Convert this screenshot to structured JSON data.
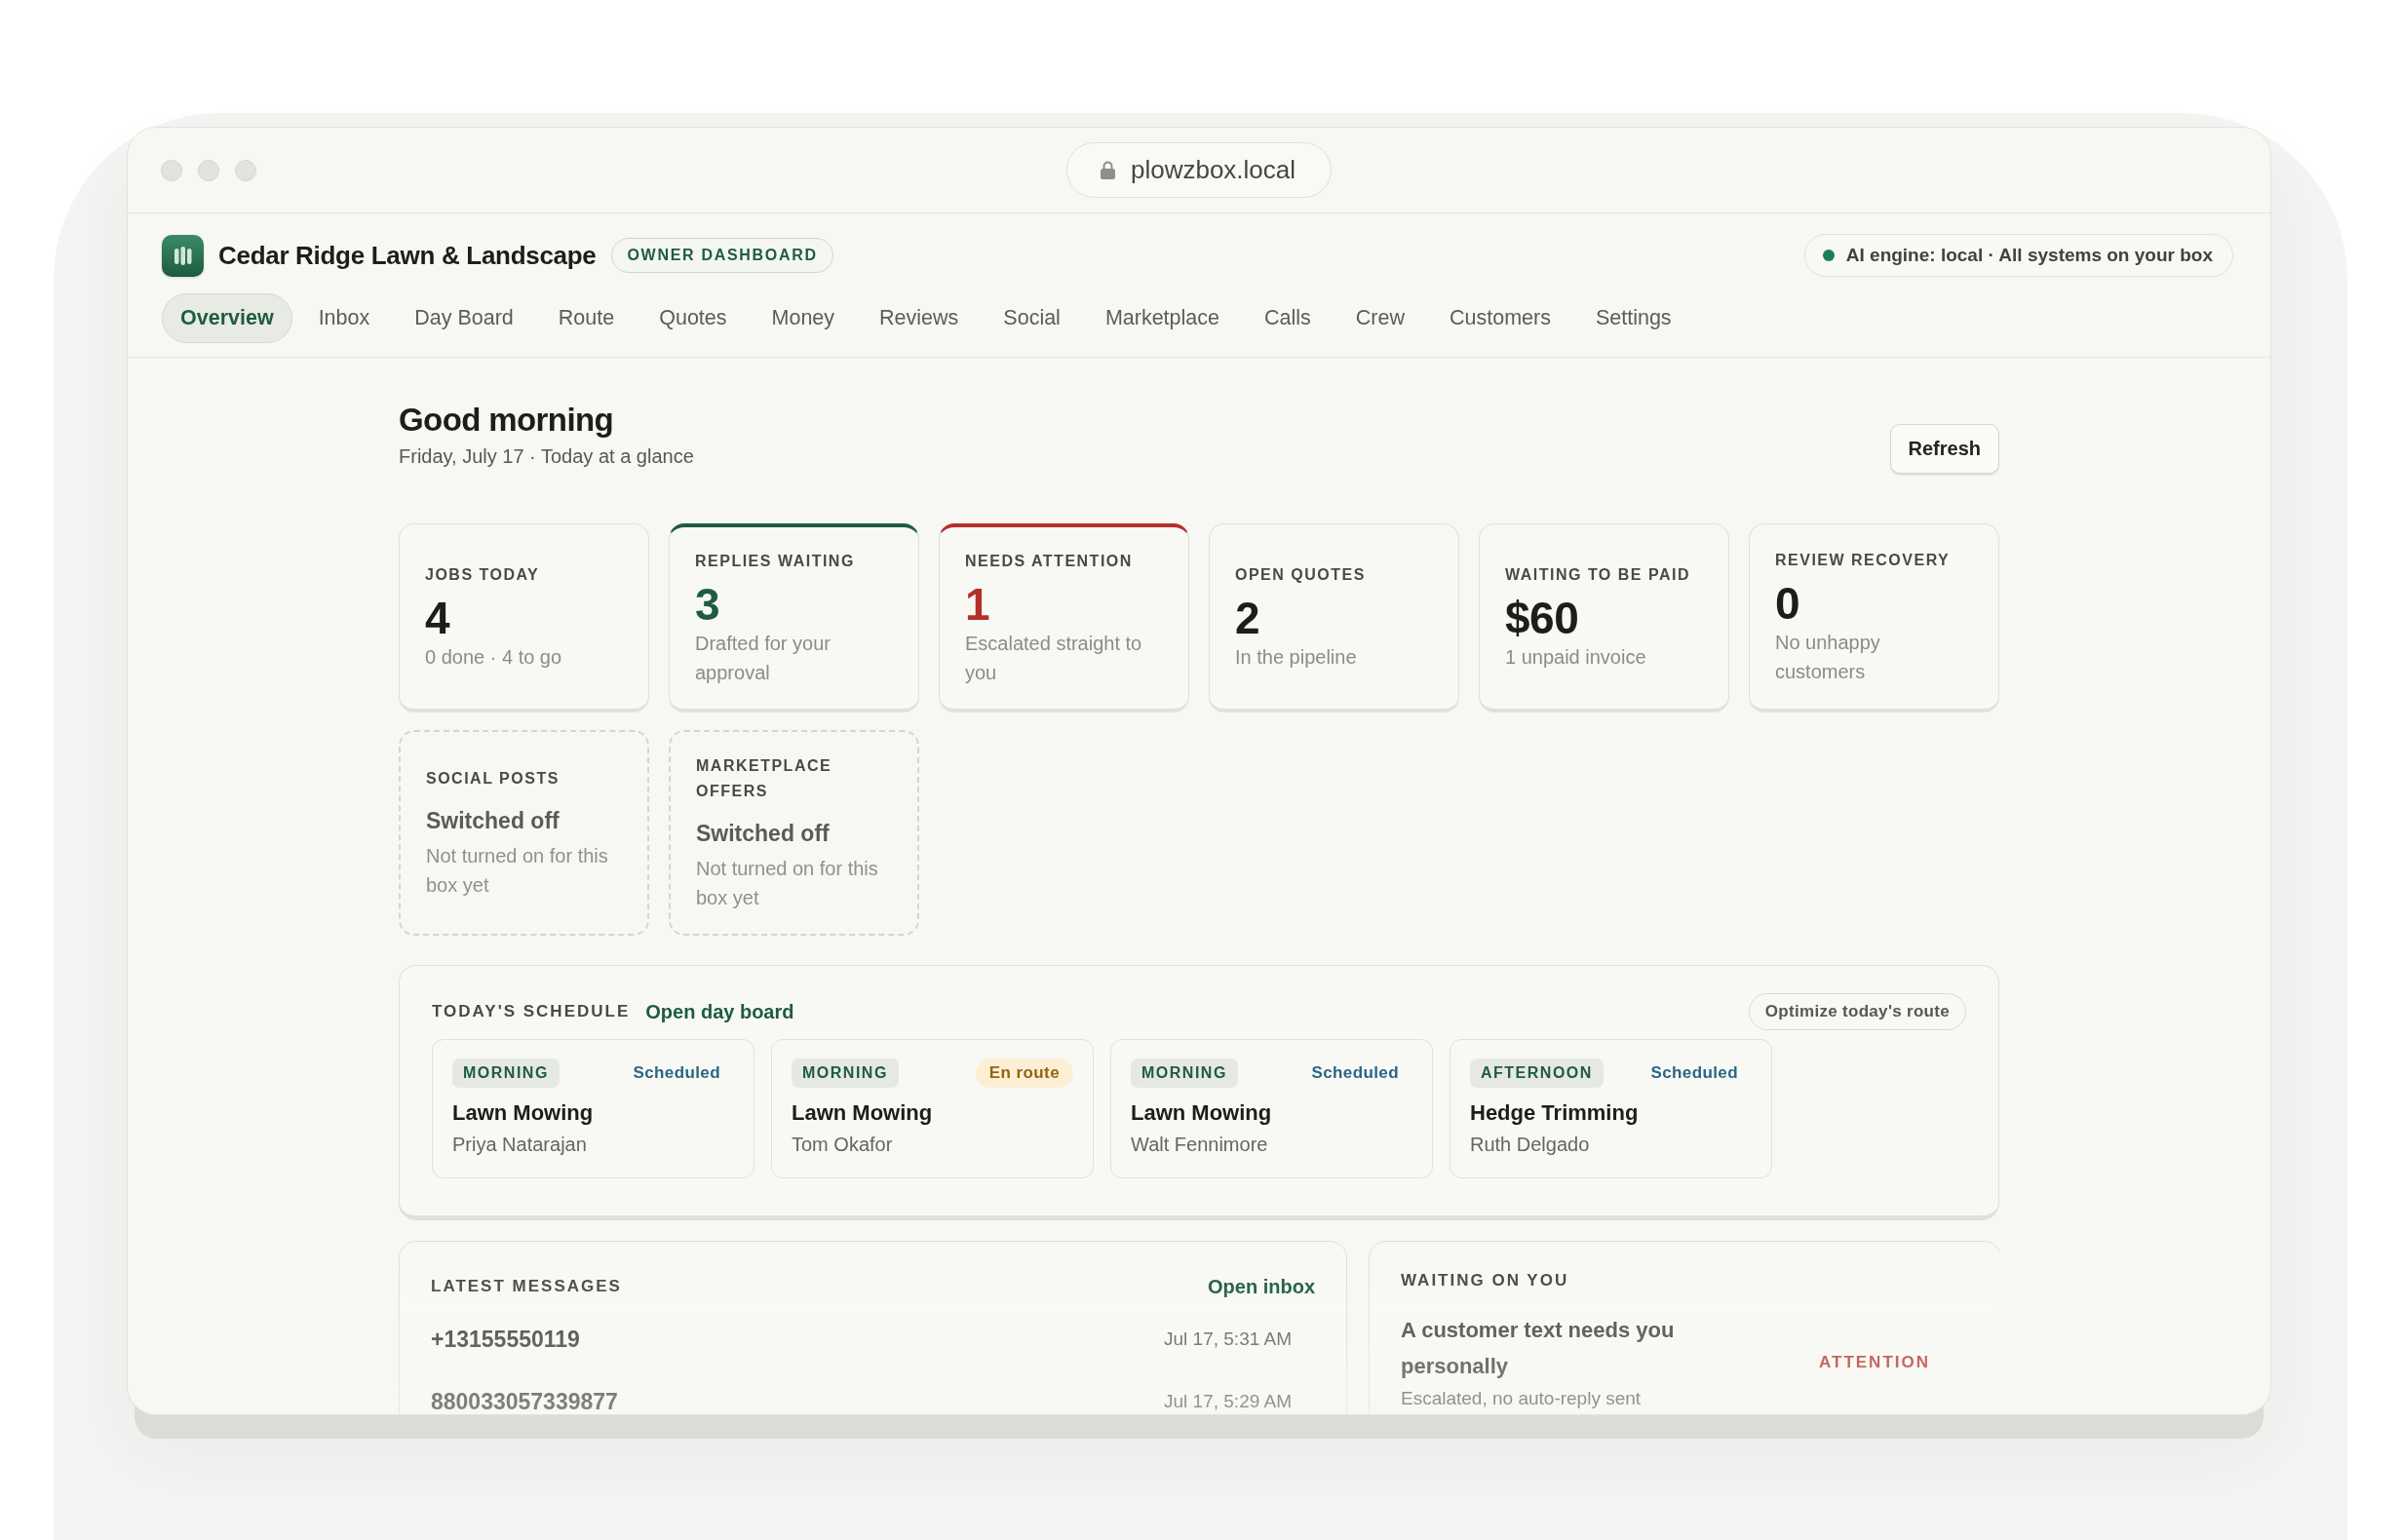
{
  "browser": {
    "url": "plowzbox.local"
  },
  "header": {
    "business_name": "Cedar Ridge Lawn & Landscape",
    "badge": "OWNER DASHBOARD",
    "status": {
      "text": "AI engine: local · All systems on your box",
      "color": "#1a7f55"
    }
  },
  "tabs": [
    {
      "label": "Overview",
      "selected": true
    },
    {
      "label": "Inbox",
      "selected": false
    },
    {
      "label": "Day Board",
      "selected": false
    },
    {
      "label": "Route",
      "selected": false
    },
    {
      "label": "Quotes",
      "selected": false
    },
    {
      "label": "Money",
      "selected": false
    },
    {
      "label": "Reviews",
      "selected": false
    },
    {
      "label": "Social",
      "selected": false
    },
    {
      "label": "Marketplace",
      "selected": false
    },
    {
      "label": "Calls",
      "selected": false
    },
    {
      "label": "Crew",
      "selected": false
    },
    {
      "label": "Customers",
      "selected": false
    },
    {
      "label": "Settings",
      "selected": false
    }
  ],
  "greeting": {
    "title": "Good morning",
    "subtitle": "Friday, July 17 · Today at a glance",
    "button": "Refresh"
  },
  "stats": [
    {
      "kind": "metric",
      "label": "JOBS TODAY",
      "value": "4",
      "note": "0 done · 4 to go"
    },
    {
      "kind": "metric",
      "label": "REPLIES WAITING",
      "value": "3",
      "note": "Drafted for your approval",
      "color": "#1f5c3f"
    },
    {
      "kind": "metric",
      "label": "NEEDS ATTENTION",
      "value": "1",
      "note": "Escalated straight to you",
      "color": "#b3312a"
    },
    {
      "kind": "metric",
      "label": "OPEN QUOTES",
      "value": "2",
      "note": "In the pipeline"
    },
    {
      "kind": "metric",
      "label": "WAITING TO BE PAID",
      "value": "$60",
      "note": "1 unpaid invoice"
    },
    {
      "kind": "metric",
      "label": "REVIEW RECOVERY",
      "value": "0",
      "note": "No unhappy customers"
    },
    {
      "kind": "off",
      "label": "SOCIAL POSTS",
      "value": "Switched off",
      "note": "Not turned on for this box yet"
    },
    {
      "kind": "off",
      "label": "MARKETPLACE OFFERS",
      "value": "Switched off",
      "note": "Not turned on for this box yet"
    }
  ],
  "schedule": {
    "title": "TODAY'S SCHEDULE",
    "link": "Open day board",
    "button": "Optimize today's route",
    "jobs": [
      {
        "slot": "MORNING",
        "status": {
          "kind": "scheduled",
          "text": "Scheduled"
        },
        "service": "Lawn Mowing",
        "customer": "Priya Natarajan"
      },
      {
        "slot": "MORNING",
        "status": {
          "kind": "en_route",
          "text": "En route"
        },
        "service": "Lawn Mowing",
        "customer": "Tom Okafor"
      },
      {
        "slot": "MORNING",
        "status": {
          "kind": "scheduled",
          "text": "Scheduled"
        },
        "service": "Lawn Mowing",
        "customer": "Walt Fennimore"
      },
      {
        "slot": "AFTERNOON",
        "status": {
          "kind": "scheduled",
          "text": "Scheduled"
        },
        "service": "Hedge Trimming",
        "customer": "Ruth Delgado"
      }
    ]
  },
  "messages": {
    "title": "LATEST MESSAGES",
    "link": "Open inbox",
    "items": [
      {
        "from": "+13155550119",
        "time": "Jul 17, 5:31 AM"
      },
      {
        "from": "880033057339877",
        "time": "Jul 17, 5:29 AM"
      }
    ]
  },
  "waiting": {
    "title": "WAITING ON YOU",
    "items": [
      {
        "title": "A customer text needs you personally",
        "detail": "Escalated, no auto-reply sent",
        "tag": "ATTENTION"
      }
    ]
  }
}
